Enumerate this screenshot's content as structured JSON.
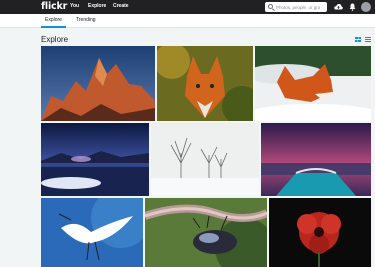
{
  "header": {
    "logo": "flickr",
    "nav": {
      "you": "You",
      "explore": "Explore",
      "create": "Create"
    },
    "search_placeholder": "Photos, people, or gro",
    "icons": [
      "upload-cloud-icon",
      "bell-icon"
    ]
  },
  "subnav": {
    "tabs": [
      "Explore",
      "Trending"
    ],
    "active": "Explore",
    "accent": "#128fdc"
  },
  "page": {
    "title": "Explore",
    "view_icons": [
      "justified-grid-icon",
      "list-view-icon"
    ]
  },
  "photos": [
    "mountain-sunset-photo",
    "red-fox-autumn-photo",
    "red-fox-snow-photo",
    "night-lake-aurora-photo",
    "snowy-trees-photo",
    "ship-bow-sunset-photo",
    "white-egret-photo",
    "beetle-on-branch-photo",
    "red-flower-photo"
  ]
}
